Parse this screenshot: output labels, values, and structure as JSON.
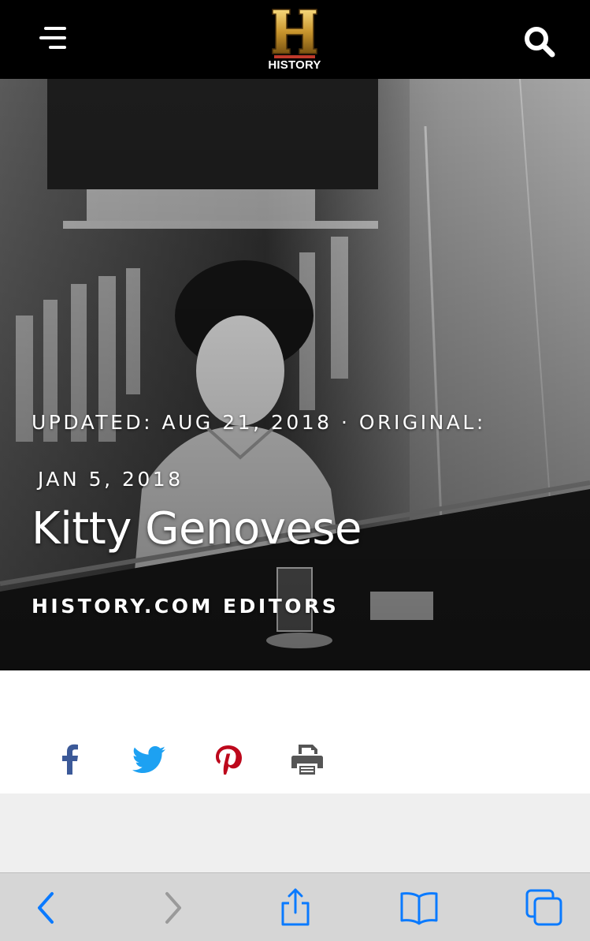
{
  "header": {
    "logo_letter": "H",
    "logo_text": "HISTORY",
    "menu_icon": "hamburger-menu-icon",
    "search_icon": "search-icon"
  },
  "hero": {
    "meta_line_1": "UPDATED: AUG 21, 2018 · ORIGINAL:",
    "meta_line_2": "JAN 5, 2018",
    "title": "Kitty Genovese",
    "author": "HISTORY.COM EDITORS"
  },
  "share": {
    "items": [
      {
        "icon": "facebook-icon",
        "color": "#3b5998"
      },
      {
        "icon": "twitter-icon",
        "color": "#1da1f2"
      },
      {
        "icon": "pinterest-icon",
        "color": "#bd081c"
      },
      {
        "icon": "print-icon",
        "color": "#555555"
      }
    ]
  },
  "browser_toolbar": {
    "icons": [
      "back-icon",
      "forward-icon",
      "share-icon",
      "bookmarks-icon",
      "tabs-icon"
    ],
    "accent": "#0a7aff"
  }
}
